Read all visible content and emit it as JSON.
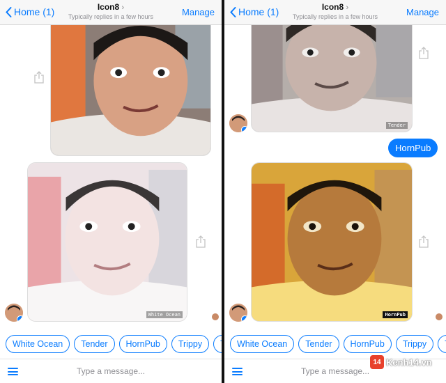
{
  "screens": [
    {
      "nav": {
        "back": "Home (1)",
        "title": "Icon8",
        "title_chevron": "›",
        "subtitle": "Typically replies in a few hours",
        "manage": "Manage"
      },
      "photos": [
        {
          "filter": "original",
          "watermark": ""
        },
        {
          "filter": "White Ocean",
          "watermark": "White Ocean"
        }
      ],
      "chips": [
        "White Ocean",
        "Tender",
        "HornPub",
        "Trippy",
        "T"
      ],
      "composer": {
        "placeholder": "Type a message..."
      }
    },
    {
      "nav": {
        "back": "Home (1)",
        "title": "Icon8",
        "title_chevron": "›",
        "subtitle": "Typically replies in a few hours",
        "manage": "Manage"
      },
      "photos": [
        {
          "filter": "sketch",
          "watermark": "Tender"
        },
        {
          "filter": "HornPub",
          "watermark": "HornPub"
        }
      ],
      "sent_message": "HornPub",
      "chips": [
        "White Ocean",
        "Tender",
        "HornPub",
        "Trippy",
        "T"
      ],
      "composer": {
        "placeholder": "Type a message..."
      }
    }
  ],
  "branding": {
    "badge": "14",
    "text": "Kenh14.vn"
  },
  "colors": {
    "accent": "#0a7cff",
    "brand": "#e8412c"
  }
}
